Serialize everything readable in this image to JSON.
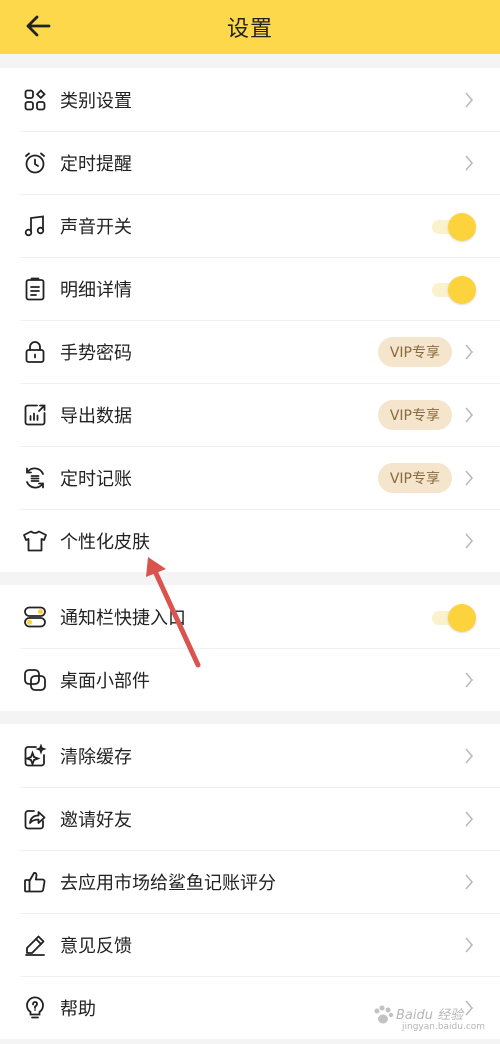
{
  "header": {
    "title": "设置"
  },
  "group1": [
    {
      "name": "category-settings",
      "label": "类别设置",
      "icon": "grid-icon",
      "right": "chevron"
    },
    {
      "name": "timed-reminder",
      "label": "定时提醒",
      "icon": "alarm-clock-icon",
      "right": "chevron"
    },
    {
      "name": "sound-switch",
      "label": "声音开关",
      "icon": "music-note-icon",
      "right": "toggle",
      "toggle_on": true
    },
    {
      "name": "detail-info",
      "label": "明细详情",
      "icon": "clipboard-icon",
      "right": "toggle",
      "toggle_on": true
    },
    {
      "name": "gesture-password",
      "label": "手势密码",
      "icon": "lock-icon",
      "right": "vip",
      "badge": "VIP专享"
    },
    {
      "name": "export-data",
      "label": "导出数据",
      "icon": "chart-export-icon",
      "right": "vip",
      "badge": "VIP专享"
    },
    {
      "name": "timed-bookkeeping",
      "label": "定时记账",
      "icon": "cycle-list-icon",
      "right": "vip",
      "badge": "VIP专享"
    },
    {
      "name": "personalized-skin",
      "label": "个性化皮肤",
      "icon": "tshirt-icon",
      "right": "chevron"
    }
  ],
  "group2": [
    {
      "name": "notification-shortcut",
      "label": "通知栏快捷入口",
      "icon": "toggle-panel-icon",
      "right": "toggle",
      "toggle_on": true
    },
    {
      "name": "desktop-widget",
      "label": "桌面小部件",
      "icon": "widget-icon",
      "right": "chevron"
    }
  ],
  "group3": [
    {
      "name": "clear-cache",
      "label": "清除缓存",
      "icon": "sparkle-broom-icon",
      "right": "chevron"
    },
    {
      "name": "invite-friends",
      "label": "邀请好友",
      "icon": "share-icon",
      "right": "chevron"
    },
    {
      "name": "rate-app",
      "label": "去应用市场给鲨鱼记账评分",
      "icon": "thumbs-up-icon",
      "right": "chevron"
    },
    {
      "name": "feedback",
      "label": "意见反馈",
      "icon": "pencil-icon",
      "right": "chevron"
    },
    {
      "name": "help",
      "label": "帮助",
      "icon": "lightbulb-question-icon",
      "right": "chevron"
    }
  ],
  "watermark": {
    "text": "Baidu 经验",
    "url": "jingyan.baidu.com"
  },
  "colors": {
    "accent": "#fcd84a",
    "knob": "#fcd33c",
    "vip_bg": "#f4e5cc",
    "vip_text": "#8a6a3f",
    "annotation_arrow": "#d9534f"
  }
}
